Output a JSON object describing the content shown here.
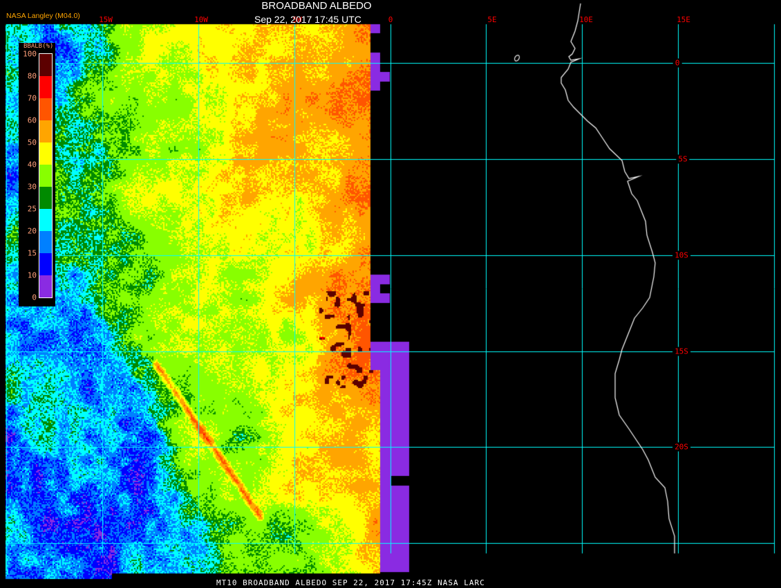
{
  "header": {
    "title": "BROADBAND ALBEDO",
    "datetime": "Sep 22, 2017 17:45 UTC",
    "credit": "NASA Langley (M04.0)"
  },
  "grid": {
    "longitude_labels": [
      "15W",
      "10W",
      "5W",
      "0",
      "5E",
      "10E",
      "15E"
    ],
    "latitude_labels": [
      "0",
      "5S",
      "10S",
      "15S",
      "20S"
    ]
  },
  "colorbar": {
    "title": "BBALB(%)",
    "labels": [
      "100",
      "80",
      "70",
      "60",
      "50",
      "40",
      "30",
      "25",
      "20",
      "15",
      "10",
      "0"
    ],
    "colors": [
      "#5c0000",
      "#ff0000",
      "#ff5500",
      "#ffa500",
      "#ffff00",
      "#88ff00",
      "#008a00",
      "#00ffff",
      "#0080ff",
      "#0000ff",
      "#8a2be2"
    ],
    "bins": [
      [
        80,
        100
      ],
      [
        70,
        80
      ],
      [
        60,
        70
      ],
      [
        50,
        60
      ],
      [
        40,
        50
      ],
      [
        30,
        40
      ],
      [
        25,
        30
      ],
      [
        20,
        25
      ],
      [
        15,
        20
      ],
      [
        10,
        15
      ],
      [
        0,
        10
      ]
    ]
  },
  "colors": {
    "gridline": "#00ffff",
    "grid_label": "#ff0000",
    "coastline": "#ffffff",
    "no_data": "#8a2be2"
  },
  "footer": {
    "caption": "MT10  BROADBAND ALBEDO   SEP 22, 2017 17:45Z   NASA LARC"
  }
}
